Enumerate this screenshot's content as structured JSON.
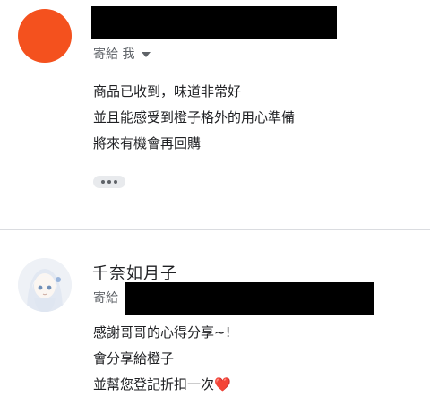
{
  "message1": {
    "to_label": "寄給 我",
    "lines": [
      "商品已收到，味道非常好",
      "並且能感受到橙子格外的用心準備",
      "將來有機會再回購"
    ]
  },
  "message2": {
    "sender_name": "千奈如月子",
    "to_label": "寄給",
    "lines": [
      "感謝哥哥的心得分享~!",
      "會分享給橙子",
      "並幫您登記折扣一次"
    ],
    "heart": "❤️"
  },
  "colors": {
    "avatar_orange": "#f4511e",
    "divider": "#dadce0",
    "heart": "#e53935"
  },
  "icons": {
    "expand": "chevron-down-icon",
    "more": "more-horizontal-icon"
  }
}
